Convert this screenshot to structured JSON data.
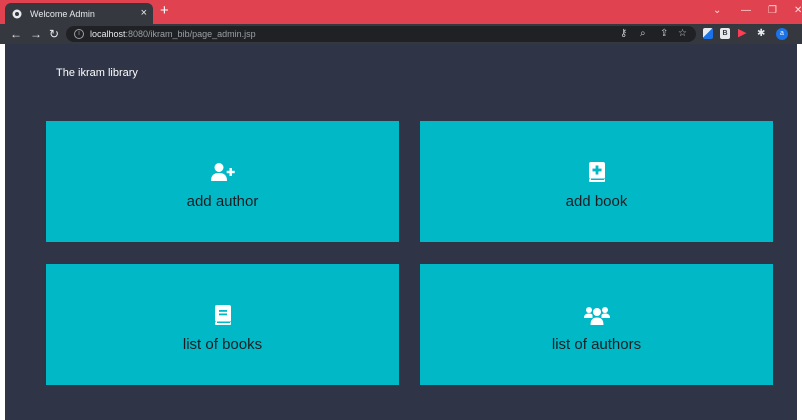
{
  "browser": {
    "tab_title": "Welcome Admin",
    "tab_close": "×",
    "new_tab": "+",
    "url_host": "localhost",
    "url_rest": ":8080/ikram_bib/page_admin.jsp",
    "profile_initial": "a",
    "extension_label": "B",
    "icons": [
      "back-icon",
      "forward-icon",
      "reload-icon",
      "info-icon",
      "key-icon",
      "zoom-icon",
      "share-icon",
      "star-icon",
      "extensions-icon"
    ]
  },
  "page": {
    "brand": "The ikram library",
    "cards": [
      {
        "label": "add author",
        "icon": "user-plus-icon"
      },
      {
        "label": "add book",
        "icon": "book-medical-icon"
      },
      {
        "label": "list of books",
        "icon": "book-icon"
      },
      {
        "label": "list of authors",
        "icon": "users-icon"
      }
    ]
  },
  "colors": {
    "tab_strip": "#e0424f",
    "toolbar": "#35393f",
    "page_background": "#2f3447",
    "card_background": "#00b8c6",
    "card_text": "#1e1e24"
  }
}
